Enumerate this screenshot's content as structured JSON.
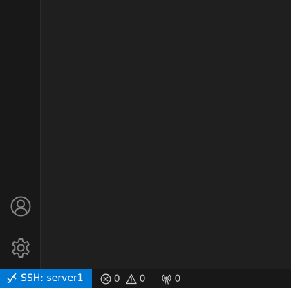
{
  "activity_bar": {
    "accounts_icon": "account-icon",
    "manage_icon": "gear-icon"
  },
  "status_bar": {
    "remote": {
      "icon": "remote-icon",
      "label": "SSH: server1",
      "background": "#0078d4"
    },
    "problems": {
      "errors_icon": "error-icon",
      "errors": "0",
      "warnings_icon": "warning-icon",
      "warnings": "0"
    },
    "ports": {
      "icon": "broadcast-icon",
      "count": "0"
    }
  },
  "colors": {
    "editor_background": "#1f1f1f",
    "activity_bar_background": "#181818",
    "status_bar_background": "#181818",
    "icon_color": "#858585",
    "status_text": "#cccccc"
  }
}
